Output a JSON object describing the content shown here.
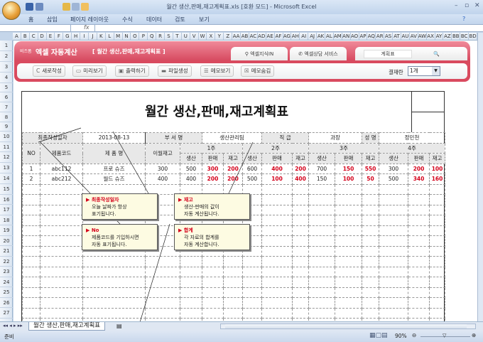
{
  "window": {
    "title": "월간 생산,판매,재고계획표.xls  [호환 모드] - Microsoft Excel"
  },
  "ribbon": {
    "tabs": [
      "홈",
      "삽입",
      "페이지 레이아웃",
      "수식",
      "데이터",
      "검토",
      "보기"
    ]
  },
  "formula_bar": {
    "fx": "fx",
    "name_box": "",
    "value": ""
  },
  "columns": [
    "A",
    "B",
    "C",
    "D",
    "E",
    "F",
    "G",
    "H",
    "I",
    "J",
    "K",
    "L",
    "M",
    "N",
    "O",
    "P",
    "Q",
    "R",
    "S",
    "T",
    "U",
    "V",
    "W",
    "X",
    "Y",
    "Z",
    "AA",
    "AB",
    "AC",
    "AD",
    "AE",
    "AF",
    "AG",
    "AH",
    "AI",
    "AJ",
    "AK",
    "AL",
    "AM",
    "AN",
    "AO",
    "AP",
    "AQ",
    "AR",
    "AS",
    "AT",
    "AU",
    "AV",
    "AW",
    "AX",
    "AY",
    "AZ",
    "BB",
    "BC",
    "BD"
  ],
  "banner": {
    "brand_small": "비즈폼",
    "brand": "엑셀 자동계산",
    "subtitle": "[ 월간 생산,판매,재고계획표 ]",
    "tabs": [
      "엑셀지식IN",
      "엑셀상담 서비스"
    ],
    "search_value": "계획표",
    "buttons": [
      "새로작성",
      "미리보기",
      "출력하기",
      "파일생성",
      "메모보기",
      "메모숨김"
    ],
    "approval_label": "결재란",
    "approval_value": "1개"
  },
  "sheet": {
    "title": "월간 생산,판매,재고계획표",
    "info": {
      "date_label": "최종작성일자",
      "date": "2013-08-13",
      "dept_label": "부 서 명",
      "dept": "생산관리팀",
      "rank_label": "직  급",
      "rank": "과장",
      "name_label": "성  명",
      "name": "정민천"
    },
    "headers": {
      "no": "NO",
      "code": "제품코드",
      "product": "제  품  명",
      "carry": "이월재고",
      "weeks": [
        "1주",
        "2주",
        "3주",
        "4주"
      ],
      "sub": [
        "생산",
        "판매",
        "재고"
      ]
    },
    "rows": [
      {
        "no": "1",
        "code": "abc112",
        "product": "프로 슈즈",
        "carry": "300",
        "weeks": [
          [
            "500",
            "300",
            "200"
          ],
          [
            "600",
            "400",
            "200"
          ],
          [
            "700",
            "150",
            "550"
          ],
          [
            "300",
            "200",
            "100"
          ]
        ]
      },
      {
        "no": "2",
        "code": "abc212",
        "product": "월드 슈즈",
        "carry": "400",
        "weeks": [
          [
            "400",
            "200",
            "200"
          ],
          [
            "500",
            "100",
            "400"
          ],
          [
            "150",
            "100",
            "50"
          ],
          [
            "500",
            "340",
            "160"
          ]
        ]
      }
    ]
  },
  "notes": [
    {
      "title": "최종작성일자",
      "lines": [
        "오늘 날짜가 항상",
        "표기됩니다."
      ]
    },
    {
      "title": "No",
      "lines": [
        "제품코드를 기입하시면",
        "자동 표기됩니다."
      ]
    },
    {
      "title": "재고",
      "lines": [
        "생산-판매의 값이",
        "자동 계산됩니다."
      ]
    },
    {
      "title": "합계",
      "lines": [
        "각 자료의 합계를",
        "자동 계산합니다."
      ]
    }
  ],
  "sheet_tab": "월간 생산,판매,재고계획표",
  "status": {
    "ready": "준비",
    "zoom": "90%"
  },
  "colors": {
    "accent": "#d94a5f",
    "red": "#d4001a"
  }
}
